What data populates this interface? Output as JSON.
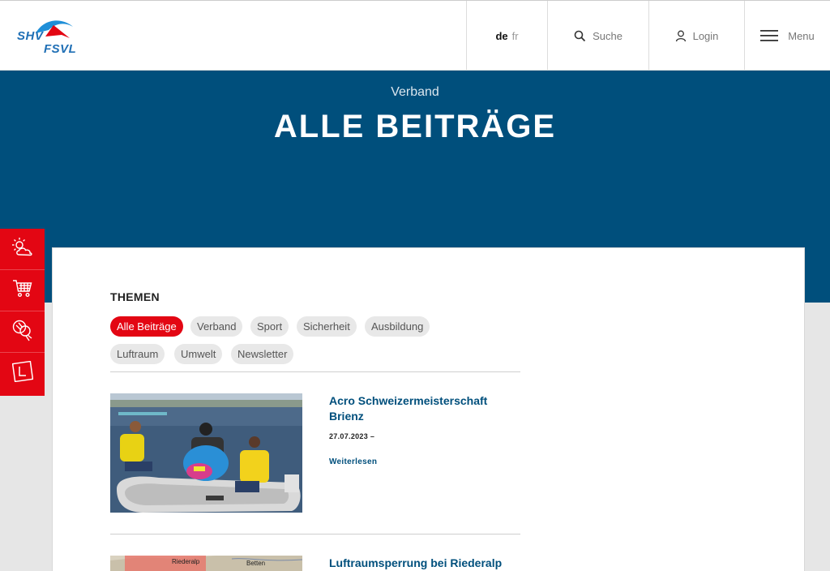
{
  "header": {
    "logo": {
      "line1": "SHV",
      "line2": "FSVL"
    },
    "lang": {
      "active": "de",
      "other": "fr"
    },
    "search_label": "Suche",
    "login_label": "Login",
    "menu_label": "Menu"
  },
  "banner": {
    "kicker": "Verband",
    "title": "ALLE BEITRÄGE"
  },
  "sidebar": {
    "items": [
      {
        "icon": "weather-icon"
      },
      {
        "icon": "cart-icon"
      },
      {
        "icon": "paragliders-icon"
      },
      {
        "icon": "learner-icon"
      }
    ]
  },
  "filters": {
    "heading": "THEMEN",
    "chips": [
      "Alle Beiträge",
      "Verband",
      "Sport",
      "Sicherheit",
      "Ausbildung",
      "Luftraum",
      "Umwelt",
      "Newsletter"
    ],
    "active": "Alle Beiträge"
  },
  "posts": [
    {
      "title": "Acro Schweizermeisterschaft Brienz",
      "date": "27.07.2023 –",
      "more": "Weiterlesen"
    },
    {
      "title": "Luftraumsperrung bei Riederalp",
      "map_labels": [
        "Riederalp",
        "Betten"
      ]
    }
  ],
  "colors": {
    "brand_blue": "#004f7c",
    "brand_red": "#e30613"
  }
}
